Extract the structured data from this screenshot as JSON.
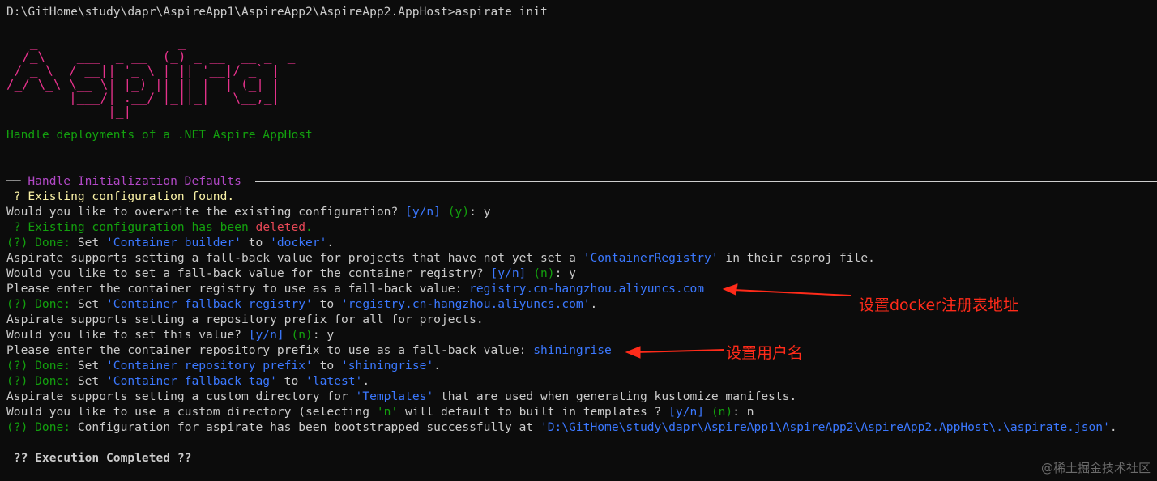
{
  "prompt": {
    "path": "D:\\GitHome\\study\\dapr\\AspireApp1\\AspireApp2\\AspireApp2.AppHost>",
    "command": "aspirate init"
  },
  "logo_art": "   _                  _\n  /_\\    ___  _ __  (_) _ __  __ _  _\n / _ \\  / __|| '_ \\ | || '__|/ _` |\n/_/ \\_\\ \\__ \\| |_) || || |  | (_| |\n        |___/| .__/ |_||_|   \\__,_|\n             |_|",
  "tagline": "Handle deployments of a .NET Aspire AppHost",
  "section_title": "Handle Initialization Defaults",
  "lines": {
    "l1": " ? Existing configuration found.",
    "l2a": "Would you like to overwrite the existing configuration? ",
    "l2b": "[y/n]",
    "l2c": " (y)",
    "l2d": ": y",
    "l3a": " ? Existing configuration has been ",
    "l3b": "deleted",
    "l3c": ".",
    "done": "(?) Done:",
    "set": " Set ",
    "to": " to ",
    "l4k": "'Container builder'",
    "l4v": "'docker'",
    "l5a": "Aspirate supports setting a fall-back value for projects that have not yet set a ",
    "l5b": "'ContainerRegistry'",
    "l5c": " in their csproj file.",
    "l6a": "Would you like to set a fall-back value for the container registry? ",
    "l6b": "[y/n]",
    "l6c": " (n)",
    "l6d": ": y",
    "l7a": "Please enter the container registry to use as a fall-back value: ",
    "l7b": "registry.cn-hangzhou.aliyuncs.com",
    "l8k": "'Container fallback registry'",
    "l8v": "'registry.cn-hangzhou.aliyuncs.com'",
    "l9": "Aspirate supports setting a repository prefix for all for projects.",
    "l10a": "Would you like to set this value? ",
    "l10b": "[y/n]",
    "l10c": " (n)",
    "l10d": ": y",
    "l11a": "Please enter the container repository prefix to use as a fall-back value: ",
    "l11b": "shiningrise",
    "l12k": "'Container repository prefix'",
    "l12v": "'shiningrise'",
    "l13k": "'Container fallback tag'",
    "l13v": "'latest'",
    "l14a": "Aspirate supports setting a custom directory for ",
    "l14b": "'Templates'",
    "l14c": " that are used when generating kustomize manifests.",
    "l15a": "Would you like to use a custom directory (selecting ",
    "l15b": "'n'",
    "l15c": " will default to built in templates ? ",
    "l15d": "[y/n]",
    "l15e": " (n)",
    "l15f": ": n",
    "l16a": " Configuration for aspirate has been bootstrapped successfully at ",
    "l16b": "'D:\\GitHome\\study\\dapr\\AspireApp1\\AspireApp2\\AspireApp2.AppHost\\.\\aspirate.json'",
    "l16c": ".",
    "completed": " ?? Execution Completed ??"
  },
  "annotations": {
    "registry_note": "设置docker注册表地址",
    "username_note": "设置用户名"
  },
  "watermark": "@稀土掘金技术社区",
  "colors": {
    "background": "#0c0c0c",
    "text": "#cccccc",
    "green": "#13a10e",
    "blue": "#3b78ff",
    "magenta": "#b148c6",
    "yellow": "#f9f1a5",
    "red": "#e74856",
    "logo": "#e6328c",
    "annotation": "#ff2b1a"
  }
}
